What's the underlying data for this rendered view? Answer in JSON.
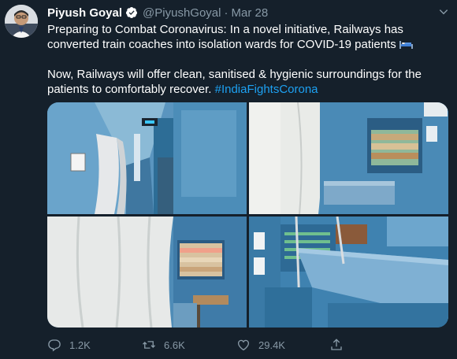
{
  "author": {
    "name": "Piyush Goyal",
    "handle": "@PiyushGoyal",
    "date": "Mar 28"
  },
  "text": {
    "line1": "Preparing to Combat Coronavirus: In a novel initiative, Railways has converted train coaches into isolation wards for COVID-19 patients",
    "emoji": "bed-emoji",
    "line2": "Now, Railways will offer clean, sanitised & hygienic surroundings for the patients to comfortably recover. ",
    "hashtag": "#IndiaFightsCorona"
  },
  "stats": {
    "replies": "1.2K",
    "retweets": "6.6K",
    "likes": "29.4K"
  },
  "colors": {
    "background": "#15202b",
    "muted": "#8899a6",
    "link": "#1da1f2",
    "coach_blue": "#4f8fb8"
  },
  "icons": [
    "verified-icon",
    "chevron-down-icon",
    "reply-icon",
    "retweet-icon",
    "like-icon",
    "share-icon"
  ]
}
